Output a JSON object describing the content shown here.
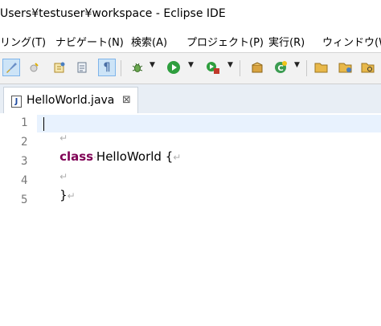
{
  "window": {
    "title": "Users¥testuser¥workspace - Eclipse IDE"
  },
  "menu": [
    {
      "label": "リング(T)"
    },
    {
      "label": "ナビゲート(N)"
    },
    {
      "label": "検索(A)"
    },
    {
      "label": "プロジェクト(P)"
    },
    {
      "label": "実行(R)"
    },
    {
      "label": "ウィンドウ(W)"
    }
  ],
  "toolbar": {
    "icons": [
      "brush-icon",
      "toggle-mark-occurrences-icon",
      "open-type-icon",
      "open-task-icon",
      "show-whitespace-icon",
      "debug-icon",
      "run-icon",
      "external-tools-icon",
      "new-package-icon",
      "new-class-icon",
      "open-folder-icon",
      "open-project-icon",
      "search-folder-icon"
    ]
  },
  "editor_tab": {
    "label": "HelloWorld.java",
    "icon_letter": "J",
    "close_symbol": "⊠"
  },
  "editor": {
    "lines": [
      {
        "number": "1",
        "keyword": "",
        "text": "",
        "eol": "↵"
      },
      {
        "number": "2",
        "keyword": "class",
        "text": "HelloWorld {",
        "eol": "↵"
      },
      {
        "number": "3",
        "keyword": "",
        "text": "",
        "eol": "↵"
      },
      {
        "number": "4",
        "keyword": "",
        "text": "}",
        "eol": "↵"
      },
      {
        "number": "5",
        "keyword": "",
        "text": "",
        "eol": ""
      }
    ],
    "keyword_color": "#7f0055",
    "current_line_color": "#e8f2fe"
  }
}
